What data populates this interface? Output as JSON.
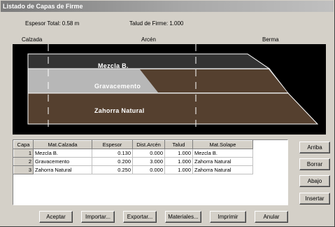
{
  "window": {
    "title": "Listado de Capas de Firme"
  },
  "summary": {
    "espesor_total": "Espesor Total: 0.58 m",
    "talud_firme": "Talud de Firme: 1.000"
  },
  "sections": {
    "calzada": "Calzada",
    "arcen": "Arcén",
    "berma": "Berma"
  },
  "preview": {
    "layers": [
      {
        "name": "Mezcla B.",
        "color": "#333333"
      },
      {
        "name": "Gravacemento",
        "color": "#b7b7b7",
        "solape_color": "#55402f"
      },
      {
        "name": "Zahorra Natural",
        "color": "#55402f"
      }
    ],
    "divider_color": "#ffffff"
  },
  "table": {
    "columns": [
      "Capa",
      "Mat.Calzada",
      "Espesor",
      "Dist.Arcén",
      "Talud",
      "Mat.Solape"
    ],
    "rows": [
      {
        "capa": "1",
        "mat_calzada": "Mezcla B.",
        "espesor": "0.130",
        "dist_arcen": "0.000",
        "talud": "1.000",
        "mat_solape": "Mezcla B."
      },
      {
        "capa": "2",
        "mat_calzada": "Gravacemento",
        "espesor": "0.200",
        "dist_arcen": "3.000",
        "talud": "1.000",
        "mat_solape": "Zahorra Natural"
      },
      {
        "capa": "3",
        "mat_calzada": "Zahorra Natural",
        "espesor": "0.250",
        "dist_arcen": "0.000",
        "talud": "1.000",
        "mat_solape": "Zahorra Natural"
      }
    ]
  },
  "side_buttons": {
    "arriba": "Arriba",
    "borrar": "Borrar",
    "abajo": "Abajo",
    "insertar": "Insertar"
  },
  "bottom_buttons": {
    "aceptar": "Aceptar",
    "importar": "Importar...",
    "exportar": "Exportar...",
    "materiales": "Materiales...",
    "imprimir": "Imprimir",
    "anular": "Anular"
  }
}
